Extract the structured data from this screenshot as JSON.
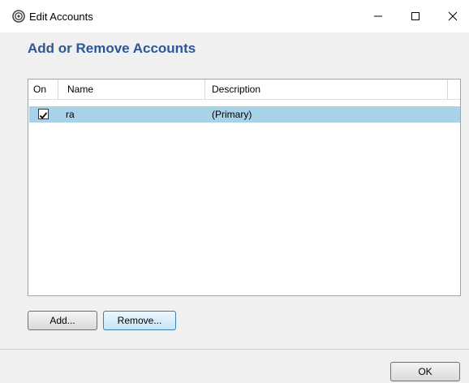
{
  "window": {
    "title": "Edit Accounts",
    "icon": "outlook-swirl-icon"
  },
  "heading": "Add or Remove Accounts",
  "list": {
    "columns": [
      "On",
      "Name",
      "Description"
    ],
    "rows": [
      {
        "on": true,
        "name": "ra",
        "description": "(Primary)",
        "selected": true
      }
    ]
  },
  "buttons": {
    "add": "Add...",
    "remove": "Remove...",
    "ok": "OK"
  },
  "colors": {
    "heading": "#2b5797",
    "selection": "#a8d2e8",
    "client_background": "#f0f0f0"
  }
}
